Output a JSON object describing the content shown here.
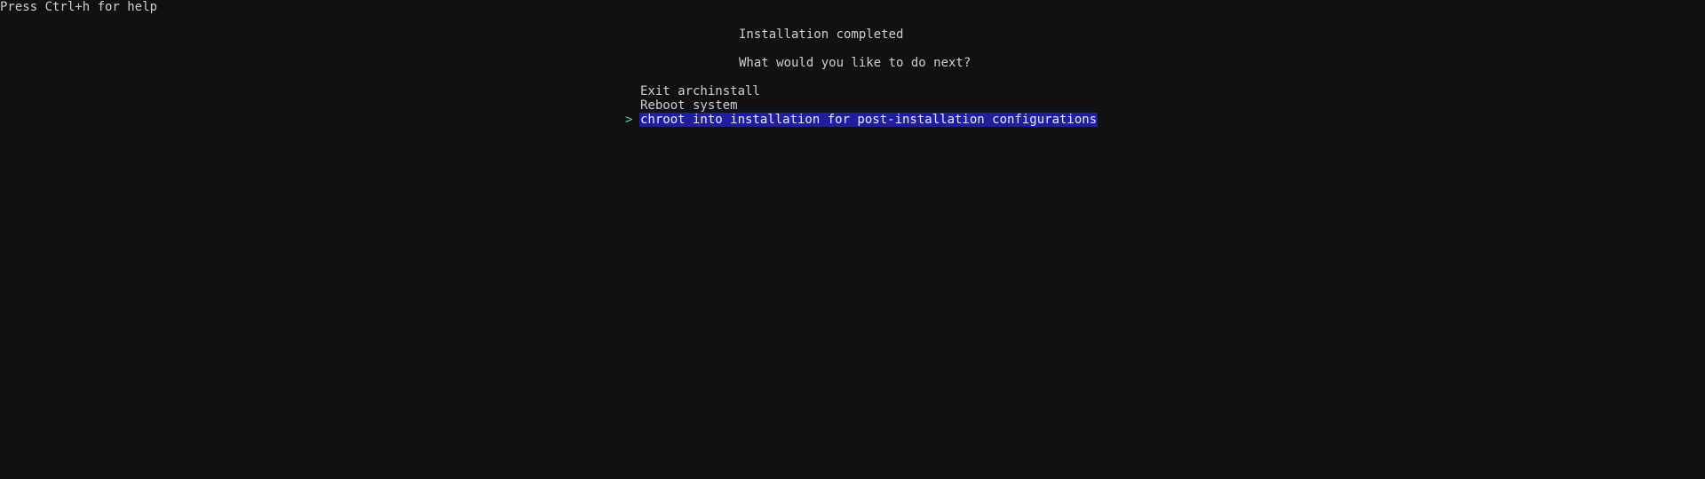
{
  "help_hint": "Press Ctrl+h for help",
  "title": "Installation completed",
  "question": "What would you like to do next?",
  "menu": {
    "cursor_glyph": ">",
    "items": [
      {
        "label": "Exit archinstall",
        "selected": false
      },
      {
        "label": "Reboot system",
        "selected": false
      },
      {
        "label": "chroot into installation for post-installation configurations",
        "selected": true
      }
    ]
  },
  "colors": {
    "background": "#111111",
    "text": "#cfcfcf",
    "selection_background": "#1f1f9e",
    "cursor": "#4fd0d0"
  }
}
